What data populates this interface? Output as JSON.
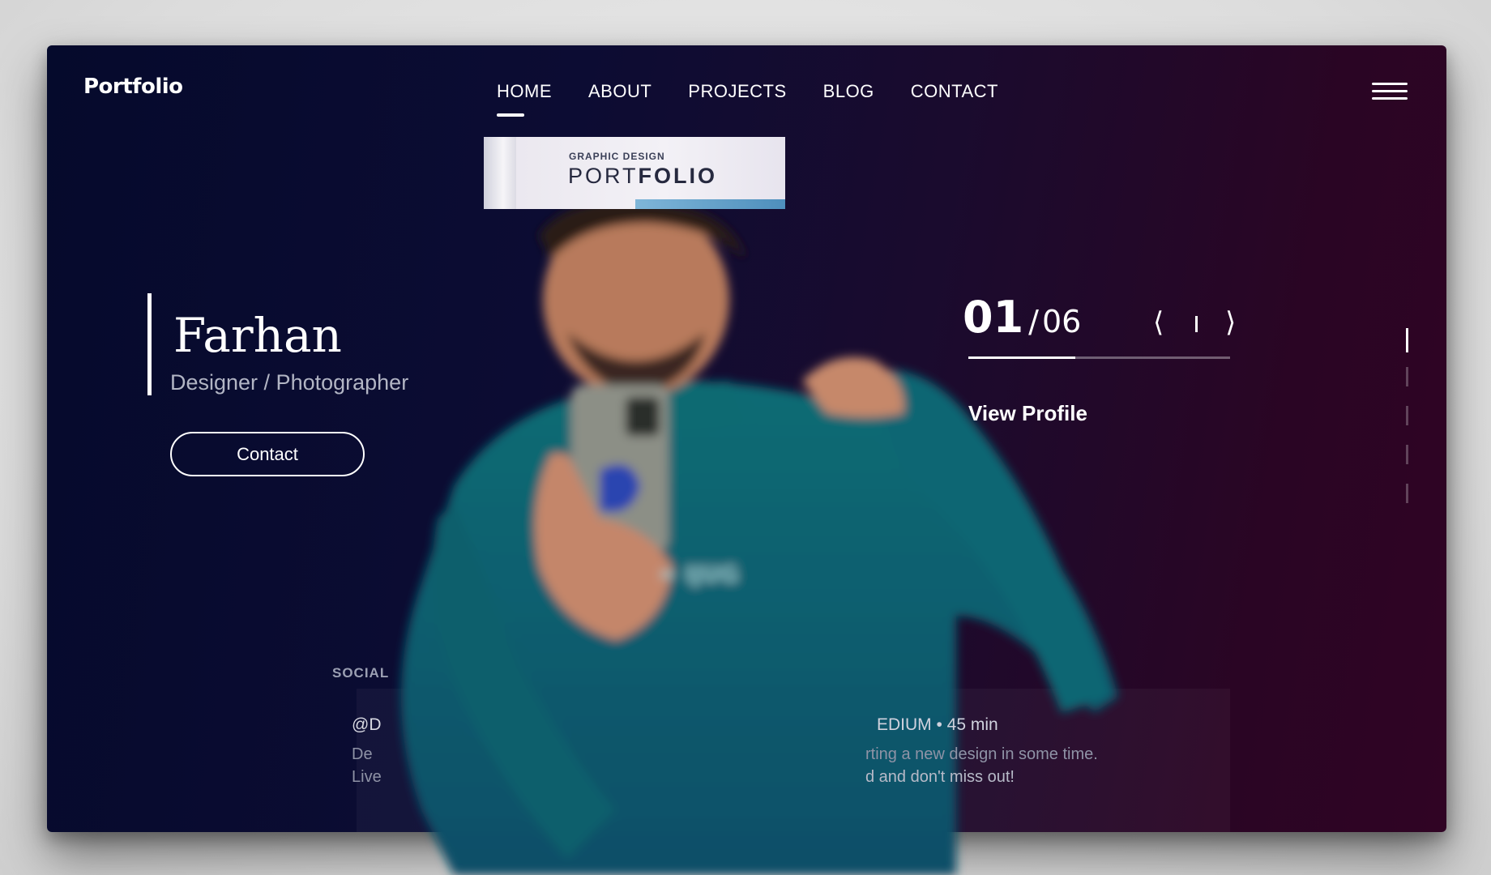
{
  "header": {
    "logo": "Portfolio",
    "nav": [
      {
        "label": "HOME",
        "active": true
      },
      {
        "label": "ABOUT",
        "active": false
      },
      {
        "label": "PROJECTS",
        "active": false
      },
      {
        "label": "BLOG",
        "active": false
      },
      {
        "label": "CONTACT",
        "active": false
      }
    ],
    "menu_icon": "hamburger-icon"
  },
  "banner": {
    "kicker": "GRAPHIC DESIGN",
    "title_light": "PORT",
    "title_bold": "FOLIO"
  },
  "hero": {
    "name": "Farhan",
    "subtitle": "Designer / Photographer",
    "contact_label": "Contact"
  },
  "slider": {
    "current": "01",
    "separator": "/",
    "total": "06",
    "progress": 0.41,
    "prev_icon": "chevron-left-icon",
    "next_icon": "chevron-right-icon",
    "view_profile": "View Profile"
  },
  "social": {
    "label": "SOCIAL",
    "handle": "@D",
    "line1": "De",
    "line2": "Live"
  },
  "post": {
    "meta": "EDIUM • 45 min",
    "line1": "rting a new design in some time.",
    "line2": "d and don't miss out!"
  },
  "colors": {
    "bg_left": "#050a2c",
    "bg_right": "#300424",
    "accent": "#ffffff"
  }
}
